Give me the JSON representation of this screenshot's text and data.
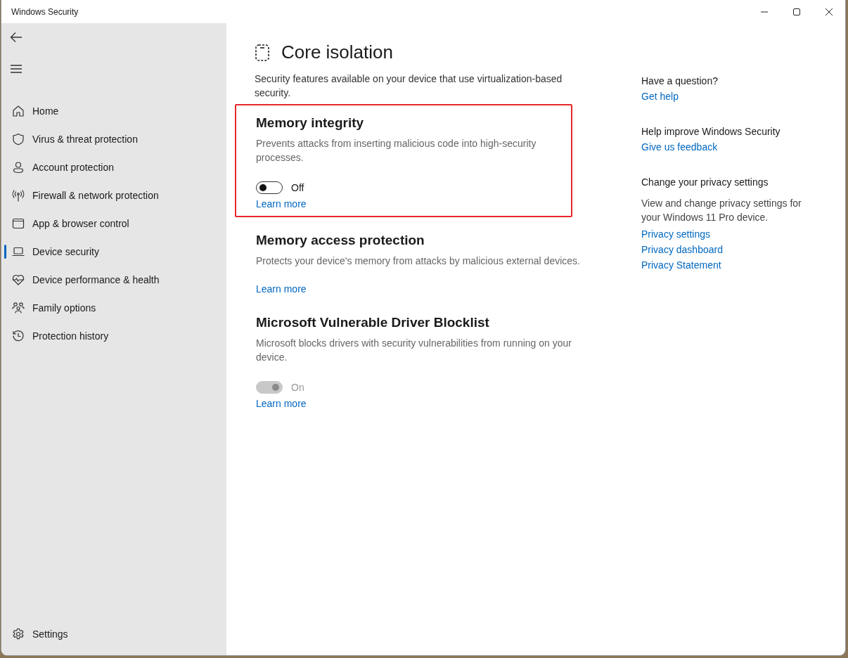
{
  "window": {
    "title": "Windows Security"
  },
  "sidebar": {
    "items": [
      {
        "label": "Home",
        "selected": false
      },
      {
        "label": "Virus & threat protection",
        "selected": false
      },
      {
        "label": "Account protection",
        "selected": false
      },
      {
        "label": "Firewall & network protection",
        "selected": false
      },
      {
        "label": "App & browser control",
        "selected": false
      },
      {
        "label": "Device security",
        "selected": true
      },
      {
        "label": "Device performance & health",
        "selected": false
      },
      {
        "label": "Family options",
        "selected": false
      },
      {
        "label": "Protection history",
        "selected": false
      }
    ],
    "footer": {
      "label": "Settings"
    }
  },
  "page": {
    "title": "Core isolation",
    "description": "Security features available on your device that use virtualization-based security.",
    "sections": [
      {
        "title": "Memory integrity",
        "description": "Prevents attacks from inserting malicious code into high-security processes.",
        "highlighted": true,
        "kind": "toggle",
        "toggle": {
          "on": false,
          "disabled": false,
          "label": "Off"
        },
        "link": "Learn more"
      },
      {
        "title": "Memory access protection",
        "description": "Protects your device's memory from attacks by malicious external devices.",
        "highlighted": false,
        "kind": "plain",
        "link": "Learn more"
      },
      {
        "title": "Microsoft Vulnerable Driver Blocklist",
        "description": "Microsoft blocks drivers with security vulnerabilities from running on your device.",
        "highlighted": false,
        "kind": "toggle",
        "toggle": {
          "on": true,
          "disabled": true,
          "label": "On"
        },
        "link": "Learn more"
      }
    ]
  },
  "aside": [
    {
      "heading": "Have a question?",
      "links": [
        "Get help"
      ]
    },
    {
      "heading": "Help improve Windows Security",
      "links": [
        "Give us feedback"
      ]
    },
    {
      "heading": "Change your privacy settings",
      "text": "View and change privacy settings for your Windows 11 Pro device.",
      "links": [
        "Privacy settings",
        "Privacy dashboard",
        "Privacy Statement"
      ]
    }
  ]
}
